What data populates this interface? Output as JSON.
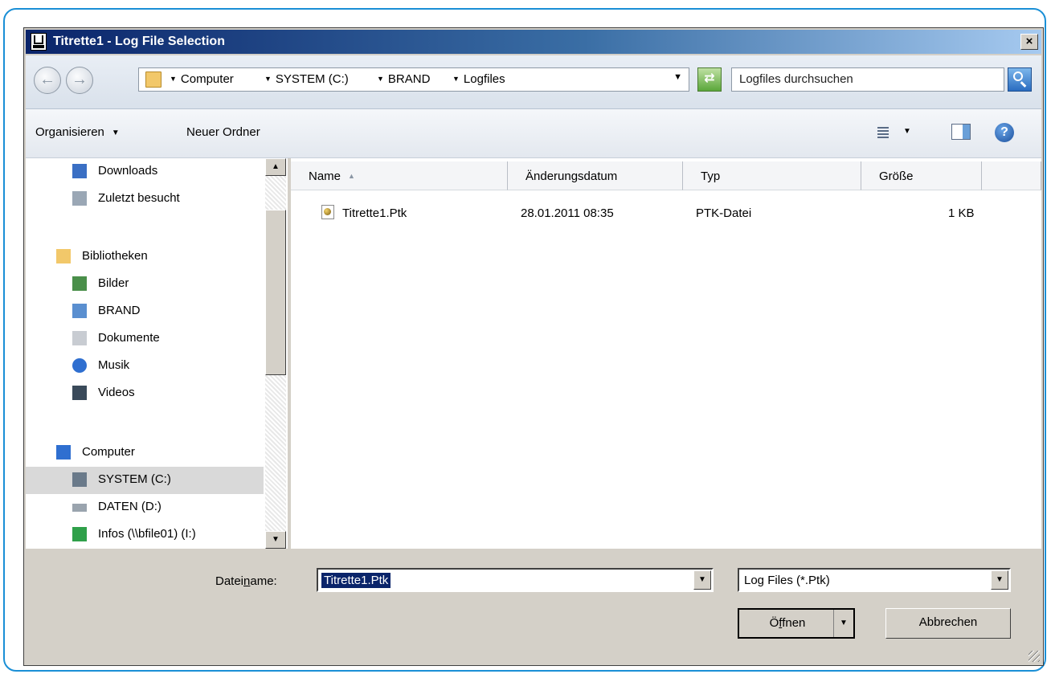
{
  "window": {
    "title": "Titrette1 - Log File Selection",
    "close_label": "×"
  },
  "nav": {
    "back_glyph": "←",
    "forward_glyph": "→",
    "breadcrumb": [
      "Computer",
      "SYSTEM (C:)",
      "BRAND",
      "Logfiles"
    ],
    "search_placeholder": "Logfiles durchsuchen"
  },
  "toolbar": {
    "organize_label": "Organisieren",
    "new_folder_label": "Neuer Ordner"
  },
  "sidebar": {
    "items": [
      {
        "label": "Downloads",
        "icon": "downloads-icon",
        "color": "#3a6fc4"
      },
      {
        "label": "Zuletzt besucht",
        "icon": "recent-places-icon",
        "color": "#9aa7b5"
      },
      {
        "label": "Bibliotheken",
        "icon": "libraries-icon",
        "color": "#f2c86a"
      },
      {
        "label": "Bilder",
        "icon": "pictures-icon",
        "color": "#4a8f4a"
      },
      {
        "label": "BRAND",
        "icon": "document-library-icon",
        "color": "#5a8fd0"
      },
      {
        "label": "Dokumente",
        "icon": "documents-icon",
        "color": "#c8ccd2"
      },
      {
        "label": "Musik",
        "icon": "music-icon",
        "color": "#2f6fd0"
      },
      {
        "label": "Videos",
        "icon": "videos-icon",
        "color": "#3a4a5a"
      },
      {
        "label": "Computer",
        "icon": "computer-icon",
        "color": "#2f6fd0"
      },
      {
        "label": "SYSTEM (C:)",
        "icon": "system-drive-icon",
        "color": "#6a7a8a"
      },
      {
        "label": "DATEN (D:)",
        "icon": "drive-icon",
        "color": "#9aa4ae"
      },
      {
        "label": "Infos (\\\\bfile01) (I:)",
        "icon": "network-drive-icon",
        "color": "#2fa04a"
      }
    ],
    "selected": "SYSTEM (C:)"
  },
  "filelist": {
    "columns": [
      "Name",
      "Änderungsdatum",
      "Typ",
      "Größe"
    ],
    "rows": [
      {
        "name": "Titrette1.Ptk",
        "date": "28.01.2011 08:35",
        "type": "PTK-Datei",
        "size": "1 KB"
      }
    ]
  },
  "bottom": {
    "filename_label_pre": "Datei",
    "filename_label_ul": "n",
    "filename_label_post": "ame:",
    "filename_value": "Titrette1.Ptk",
    "filetype_value": "Log Files (*.Ptk)",
    "open_pre": "Ö",
    "open_ul": "f",
    "open_post": "fnen",
    "cancel_label": "Abbrechen"
  },
  "colors": {
    "accent_frame": "#1a8fd6",
    "title_start": "#0a246a",
    "selection": "#0a246a"
  }
}
